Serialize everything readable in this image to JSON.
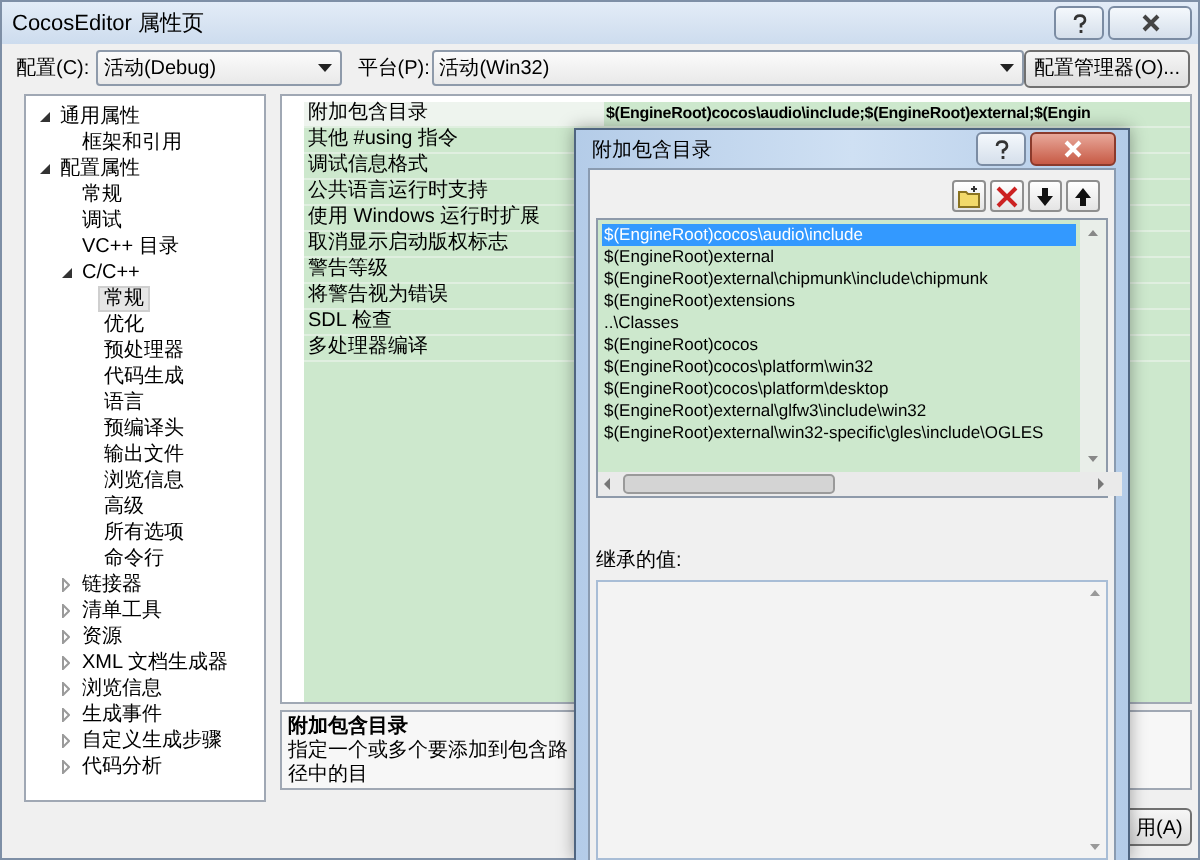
{
  "window": {
    "title": "CocosEditor 属性页"
  },
  "toolbar": {
    "configuration_label": "配置(C):",
    "configuration_value": "活动(Debug)",
    "platform_label": "平台(P):",
    "platform_value": "活动(Win32)",
    "manager_button": "配置管理器(O)..."
  },
  "tree": [
    {
      "label": "通用属性",
      "kind": "folder",
      "expanded": true,
      "selected": false,
      "children": [
        {
          "label": "框架和引用",
          "kind": "leaf",
          "selected": false
        }
      ]
    },
    {
      "label": "配置属性",
      "kind": "folder",
      "expanded": true,
      "selected": false,
      "children": [
        {
          "label": "常规",
          "kind": "leaf",
          "selected": false
        },
        {
          "label": "调试",
          "kind": "leaf",
          "selected": false
        },
        {
          "label": "VC++ 目录",
          "kind": "leaf",
          "selected": false
        },
        {
          "label": "C/C++",
          "kind": "folder",
          "expanded": true,
          "selected": false,
          "children": [
            {
              "label": "常规",
              "kind": "leaf",
              "selected": true
            },
            {
              "label": "优化",
              "kind": "leaf",
              "selected": false
            },
            {
              "label": "预处理器",
              "kind": "leaf",
              "selected": false
            },
            {
              "label": "代码生成",
              "kind": "leaf",
              "selected": false
            },
            {
              "label": "语言",
              "kind": "leaf",
              "selected": false
            },
            {
              "label": "预编译头",
              "kind": "leaf",
              "selected": false
            },
            {
              "label": "输出文件",
              "kind": "leaf",
              "selected": false
            },
            {
              "label": "浏览信息",
              "kind": "leaf",
              "selected": false
            },
            {
              "label": "高级",
              "kind": "leaf",
              "selected": false
            },
            {
              "label": "所有选项",
              "kind": "leaf",
              "selected": false
            },
            {
              "label": "命令行",
              "kind": "leaf",
              "selected": false
            }
          ]
        },
        {
          "label": "链接器",
          "kind": "folder",
          "expanded": false,
          "selected": false
        },
        {
          "label": "清单工具",
          "kind": "folder",
          "expanded": false,
          "selected": false
        },
        {
          "label": "资源",
          "kind": "folder",
          "expanded": false,
          "selected": false
        },
        {
          "label": "XML 文档生成器",
          "kind": "folder",
          "expanded": false,
          "selected": false
        },
        {
          "label": "浏览信息",
          "kind": "folder",
          "expanded": false,
          "selected": false
        },
        {
          "label": "生成事件",
          "kind": "folder",
          "expanded": false,
          "selected": false
        },
        {
          "label": "自定义生成步骤",
          "kind": "folder",
          "expanded": false,
          "selected": false
        },
        {
          "label": "代码分析",
          "kind": "folder",
          "expanded": false,
          "selected": false
        }
      ]
    }
  ],
  "properties": [
    {
      "name": "附加包含目录",
      "value": "$(EngineRoot)cocos\\audio\\include;$(EngineRoot)external;$(Engin",
      "selected": true
    },
    {
      "name": "其他 #using 指令",
      "selected": false
    },
    {
      "name": "调试信息格式",
      "selected": false
    },
    {
      "name": "公共语言运行时支持",
      "selected": false
    },
    {
      "name": "使用 Windows 运行时扩展",
      "selected": false
    },
    {
      "name": "取消显示启动版权标志",
      "selected": false
    },
    {
      "name": "警告等级",
      "selected": false
    },
    {
      "name": "将警告视为错误",
      "selected": false
    },
    {
      "name": "SDL 检查",
      "selected": false
    },
    {
      "name": "多处理器编译",
      "selected": false
    }
  ],
  "description": {
    "title": "附加包含目录",
    "text": "指定一个或多个要添加到包含路径中的目"
  },
  "apply_button": "用(A)",
  "dialog": {
    "title": "附加包含目录",
    "inherited_label": "继承的值:",
    "entries": [
      {
        "path": "$(EngineRoot)cocos\\audio\\include",
        "selected": true
      },
      {
        "path": "$(EngineRoot)external",
        "selected": false
      },
      {
        "path": "$(EngineRoot)external\\chipmunk\\include\\chipmunk",
        "selected": false
      },
      {
        "path": "$(EngineRoot)extensions",
        "selected": false
      },
      {
        "path": "..\\Classes",
        "selected": false
      },
      {
        "path": "$(EngineRoot)cocos",
        "selected": false
      },
      {
        "path": "$(EngineRoot)cocos\\platform\\win32",
        "selected": false
      },
      {
        "path": "$(EngineRoot)cocos\\platform\\desktop",
        "selected": false
      },
      {
        "path": "$(EngineRoot)external\\glfw3\\include\\win32",
        "selected": false
      },
      {
        "path": "$(EngineRoot)external\\win32-specific\\gles\\include\\OGLES",
        "selected": false
      }
    ]
  }
}
